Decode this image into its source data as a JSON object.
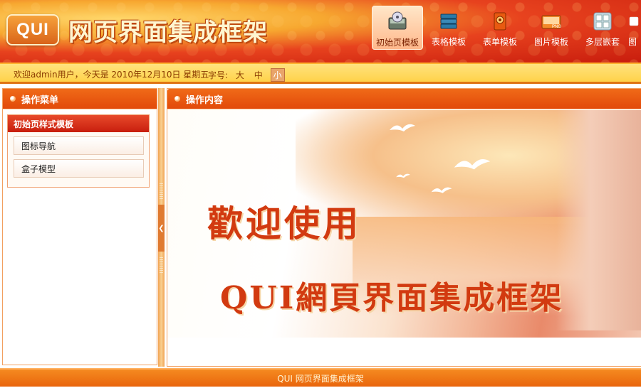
{
  "header": {
    "logo_text": "QUI",
    "title": "网页界面集成框架",
    "nav": [
      {
        "label": "初始页模板",
        "icon": "disk-drive-icon",
        "active": true
      },
      {
        "label": "表格模板",
        "icon": "stack-icon",
        "active": false
      },
      {
        "label": "表单模板",
        "icon": "gear-box-icon",
        "active": false
      },
      {
        "label": "图片模板",
        "icon": "png-image-icon",
        "active": false
      },
      {
        "label": "多层嵌套",
        "icon": "grid-icon",
        "active": false
      },
      {
        "label": "图",
        "icon": "partial-icon",
        "active": false
      }
    ]
  },
  "infobar": {
    "welcome": "欢迎admin用户，今天是 2010年12月10日 星期五",
    "font_label": "字号:",
    "font_sizes": [
      "大",
      "中",
      "小"
    ],
    "font_active": "小"
  },
  "left_panel": {
    "title": "操作菜单",
    "group_title": "初始页样式模板",
    "items": [
      "图标导航",
      "盒子模型"
    ]
  },
  "right_panel": {
    "title": "操作内容",
    "banner_line1": "歡迎使用",
    "banner_line2": "QUI網頁界面集成框架"
  },
  "footer": {
    "text": "QUI 网页界面集成框架"
  },
  "colors": {
    "accent": "#e24a0a",
    "infobar": "#ffd24a",
    "banner_text": "#d23a10"
  }
}
